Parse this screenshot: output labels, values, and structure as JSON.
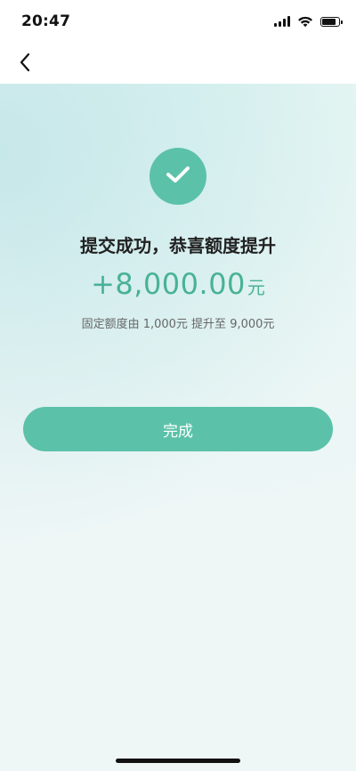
{
  "status_bar": {
    "time": "20:47",
    "icons": [
      "signal-icon",
      "wifi-icon",
      "battery-icon"
    ]
  },
  "nav": {
    "back_icon": "chevron-left-icon"
  },
  "result": {
    "icon": "check-icon",
    "headline": "提交成功，恭喜额度提升",
    "amount": "+8,000.00",
    "unit": "元",
    "subtext": "固定额度由 1,000元 提升至 9,000元"
  },
  "actions": {
    "done_label": "完成"
  },
  "colors": {
    "accent": "#5bc2a9",
    "amount_text": "#48b296",
    "background": "#eef6f6"
  }
}
